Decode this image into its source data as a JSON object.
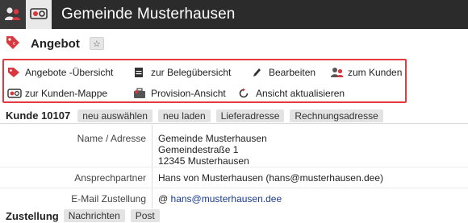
{
  "topbar": {
    "title": "Gemeinde Musterhausen"
  },
  "header": {
    "title": "Angebot",
    "star": "☆"
  },
  "toolbar": {
    "overview": "Angebote -Übersicht",
    "belege": "zur Belegübersicht",
    "edit": "Bearbeiten",
    "to_customer": "zum Kunden",
    "customer_folder": "zur Kunden-Mappe",
    "provision": "Provision-Ansicht",
    "refresh": "Ansicht aktualisieren"
  },
  "customer": {
    "label": "Kunde 10107",
    "buttons": [
      "neu auswählen",
      "neu laden",
      "Lieferadresse",
      "Rechnungsadresse"
    ],
    "fields": {
      "name_label": "Name / Adresse",
      "name_lines": [
        "Gemeinde Musterhausen",
        "Gemeindestraße 1",
        "12345 Musterhausen"
      ],
      "contact_label": "Ansprechpartner",
      "contact_value": "Hans von Musterhausen (hans@musterhausen.dee)",
      "email_label": "E-Mail Zustellung",
      "email_prefix": "@",
      "email_value": "hans@musterhausen.dee"
    }
  },
  "delivery": {
    "label": "Zustellung",
    "buttons": [
      "Nachrichten",
      "Post"
    ]
  },
  "colors": {
    "topbar": "#2b2b2b",
    "highlight_border": "#e53940",
    "tag_red": "#d9383f",
    "chip": "#e3e3e3",
    "link": "#1a3d8f"
  }
}
